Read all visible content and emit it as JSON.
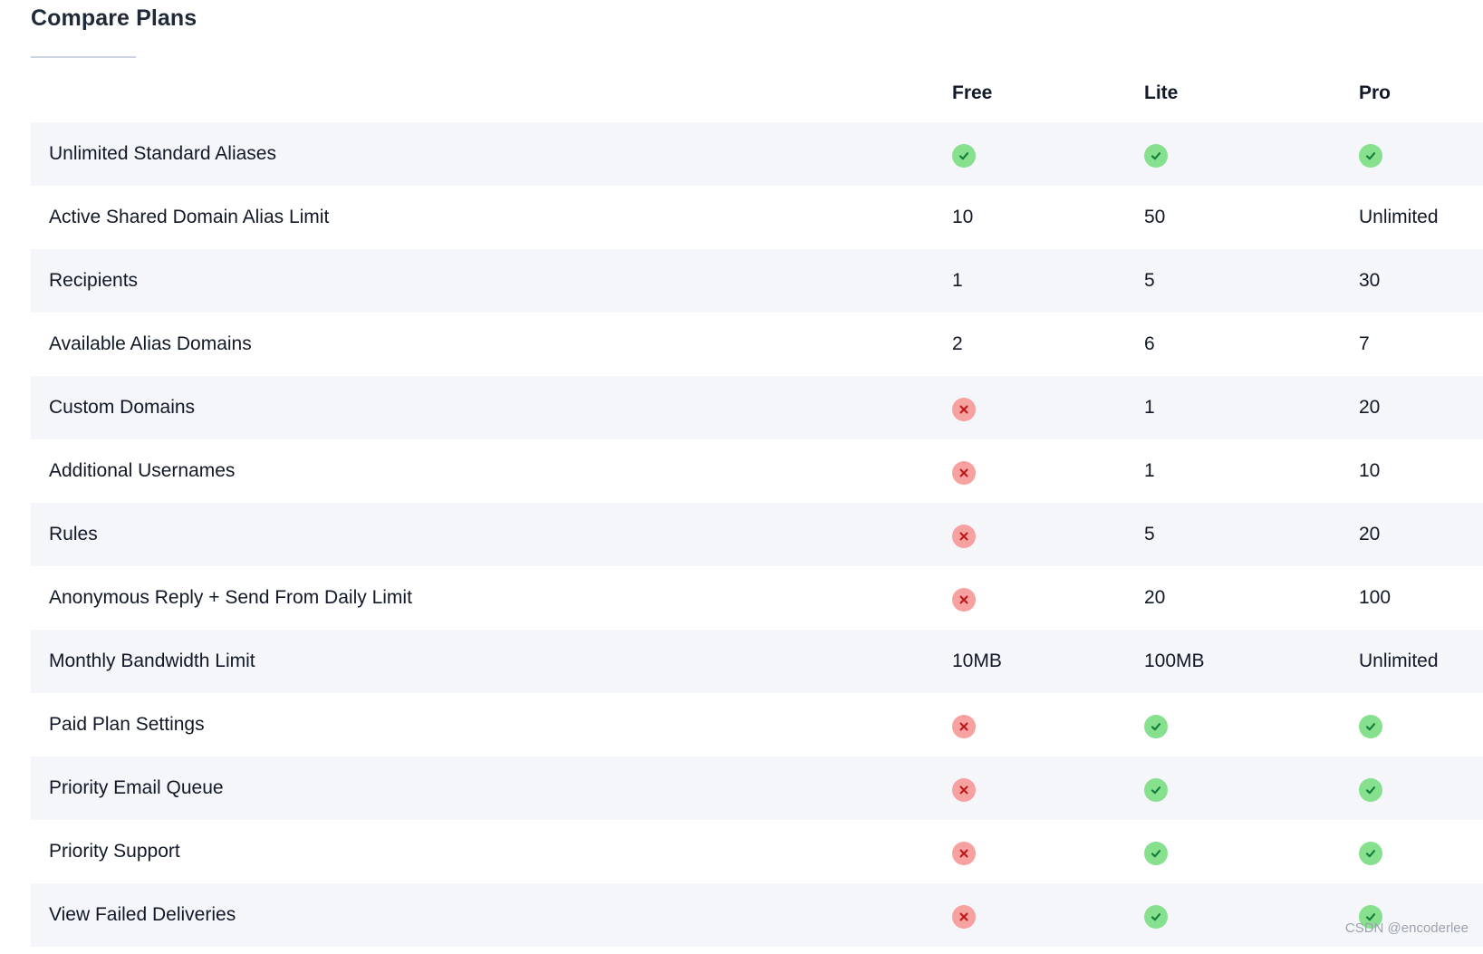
{
  "title": "Compare Plans",
  "plans": [
    "Free",
    "Lite",
    "Pro"
  ],
  "rows": [
    {
      "feature": "Unlimited Standard Aliases",
      "values": [
        {
          "type": "check"
        },
        {
          "type": "check"
        },
        {
          "type": "check"
        }
      ]
    },
    {
      "feature": "Active Shared Domain Alias Limit",
      "values": [
        {
          "type": "text",
          "text": "10"
        },
        {
          "type": "text",
          "text": "50"
        },
        {
          "type": "text",
          "text": "Unlimited"
        }
      ]
    },
    {
      "feature": "Recipients",
      "values": [
        {
          "type": "text",
          "text": "1"
        },
        {
          "type": "text",
          "text": "5"
        },
        {
          "type": "text",
          "text": "30"
        }
      ]
    },
    {
      "feature": "Available Alias Domains",
      "values": [
        {
          "type": "text",
          "text": "2"
        },
        {
          "type": "text",
          "text": "6"
        },
        {
          "type": "text",
          "text": "7"
        }
      ]
    },
    {
      "feature": "Custom Domains",
      "values": [
        {
          "type": "cross"
        },
        {
          "type": "text",
          "text": "1"
        },
        {
          "type": "text",
          "text": "20"
        }
      ]
    },
    {
      "feature": "Additional Usernames",
      "values": [
        {
          "type": "cross"
        },
        {
          "type": "text",
          "text": "1"
        },
        {
          "type": "text",
          "text": "10"
        }
      ]
    },
    {
      "feature": "Rules",
      "values": [
        {
          "type": "cross"
        },
        {
          "type": "text",
          "text": "5"
        },
        {
          "type": "text",
          "text": "20"
        }
      ]
    },
    {
      "feature": "Anonymous Reply + Send From Daily Limit",
      "values": [
        {
          "type": "cross"
        },
        {
          "type": "text",
          "text": "20"
        },
        {
          "type": "text",
          "text": "100"
        }
      ]
    },
    {
      "feature": "Monthly Bandwidth Limit",
      "values": [
        {
          "type": "text",
          "text": "10MB"
        },
        {
          "type": "text",
          "text": "100MB"
        },
        {
          "type": "text",
          "text": "Unlimited"
        }
      ]
    },
    {
      "feature": "Paid Plan Settings",
      "values": [
        {
          "type": "cross"
        },
        {
          "type": "check"
        },
        {
          "type": "check"
        }
      ]
    },
    {
      "feature": "Priority Email Queue",
      "values": [
        {
          "type": "cross"
        },
        {
          "type": "check"
        },
        {
          "type": "check"
        }
      ]
    },
    {
      "feature": "Priority Support",
      "values": [
        {
          "type": "cross"
        },
        {
          "type": "check"
        },
        {
          "type": "check"
        }
      ]
    },
    {
      "feature": "View Failed Deliveries",
      "values": [
        {
          "type": "cross"
        },
        {
          "type": "check"
        },
        {
          "type": "check"
        }
      ]
    }
  ],
  "icons": {
    "check": {
      "name": "check-circle-icon",
      "bg": "#86e08e",
      "fg": "#15803d"
    },
    "cross": {
      "name": "x-circle-icon",
      "bg": "#f8a1a1",
      "fg": "#b91c1c"
    }
  },
  "watermark": "CSDN @encoderlee"
}
